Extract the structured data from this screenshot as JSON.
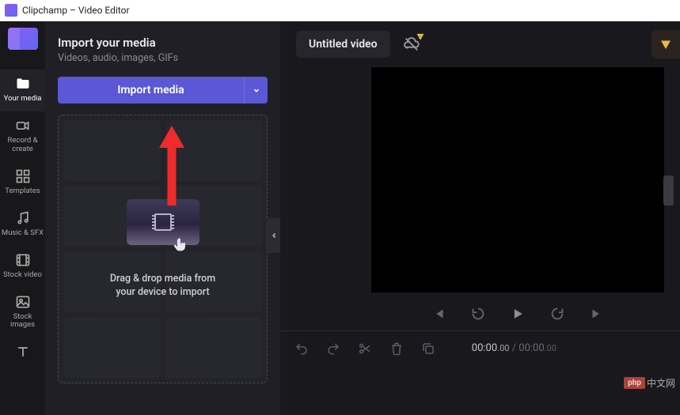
{
  "titlebar": {
    "app_name": "Clipchamp – Video Editor"
  },
  "nav": {
    "items": [
      {
        "label": "Your media",
        "icon": "folder-icon"
      },
      {
        "label": "Record & create",
        "icon": "video-camera-icon"
      },
      {
        "label": "Templates",
        "icon": "templates-icon"
      },
      {
        "label": "Music & SFX",
        "icon": "music-icon"
      },
      {
        "label": "Stock video",
        "icon": "film-icon"
      },
      {
        "label": "Stock images",
        "icon": "image-icon"
      },
      {
        "label": "",
        "icon": "text-icon"
      }
    ],
    "active_index": 0
  },
  "panel": {
    "title": "Import your media",
    "subtitle": "Videos, audio, images, GIFs",
    "import_label": "Import media",
    "dropzone_line1": "Drag & drop media from",
    "dropzone_line2": "your device to import"
  },
  "topbar": {
    "title": "Untitled video"
  },
  "player": {
    "timecode_current": "00:00",
    "timecode_current_ms": ".00",
    "timecode_duration": "00:00",
    "timecode_duration_ms": ".00",
    "separator": " / "
  },
  "watermark": {
    "badge": "php",
    "text": "中文网"
  },
  "colors": {
    "accent": "#5b57d6",
    "arrow": "#ef2b2b"
  }
}
